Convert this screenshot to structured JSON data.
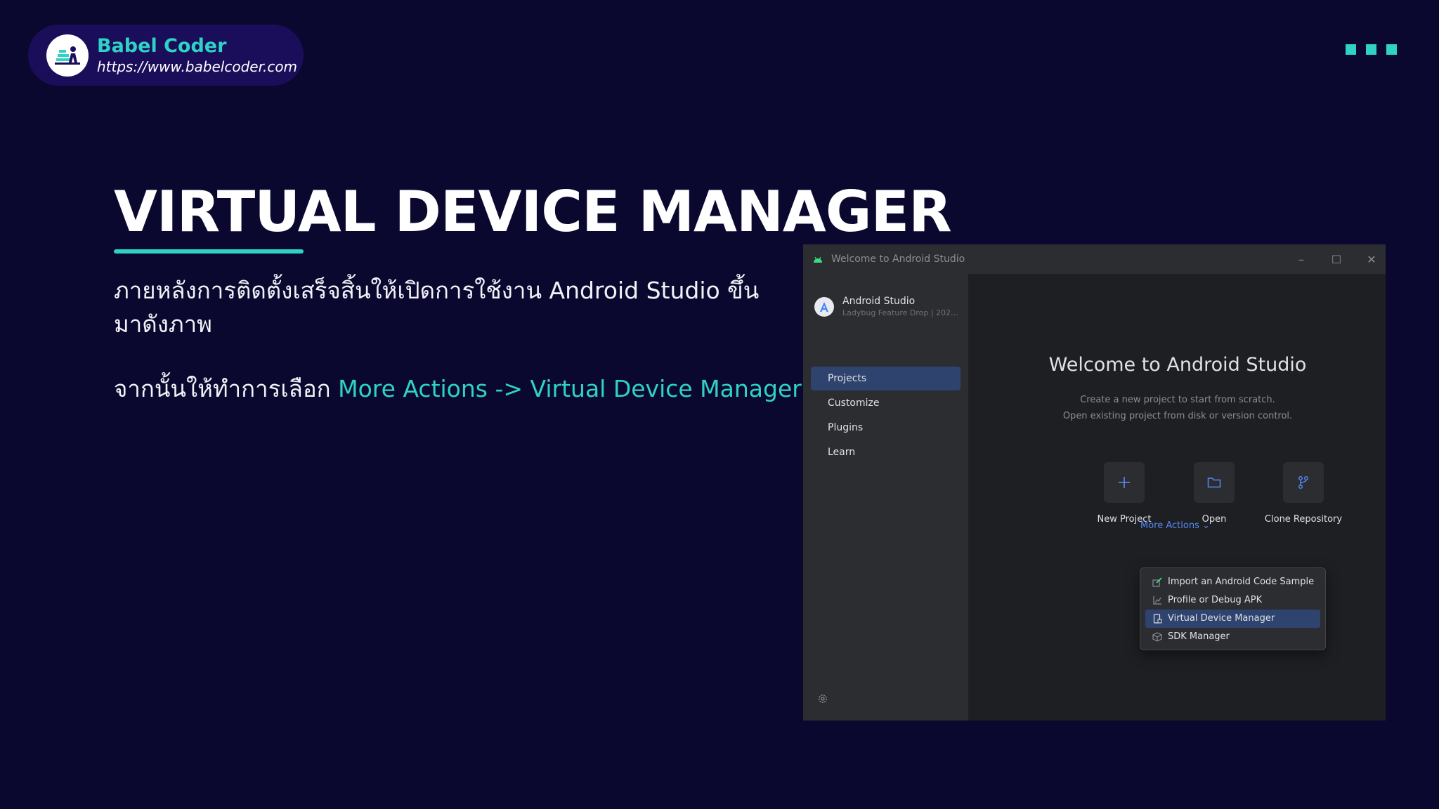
{
  "brand": {
    "name": "Babel Coder",
    "url": "https://www.babelcoder.com"
  },
  "slide": {
    "title": "VIRTUAL DEVICE MANAGER",
    "paragraph1": "ภายหลังการติดตั้งเสร็จสิ้นให้เปิดการใช้งาน Android Studio ขึ้นมาดังภาพ",
    "paragraph2_prefix": "จากนั้นให้ทำการเลือก ",
    "paragraph2_highlight": "More Actions -> Virtual Device Manager"
  },
  "window": {
    "title": "Welcome to Android Studio",
    "controls": [
      "–",
      "☐",
      "✕"
    ],
    "product_name": "Android Studio",
    "product_version": "Ladybug Feature Drop | 202…",
    "nav": [
      "Projects",
      "Customize",
      "Plugins",
      "Learn"
    ],
    "welcome_title": "Welcome to Android Studio",
    "subtitle1": "Create a new project to start from scratch.",
    "subtitle2": "Open existing project from disk or version control.",
    "actions": [
      "New Project",
      "Open",
      "Clone Repository"
    ],
    "more_actions_label": "More Actions ⌄",
    "menu": [
      "Import an Android Code Sample",
      "Profile or Debug APK",
      "Virtual Device Manager",
      "SDK Manager"
    ]
  },
  "colors": {
    "background": "#0b0830",
    "accent": "#2ed3c6",
    "brand_pill": "#1a0e5a",
    "ide_selection": "#2e436e",
    "ide_link": "#548af7"
  },
  "icons": {
    "window": "android-icon",
    "gear": "gear-icon",
    "new_project": "plus-icon",
    "open": "folder-icon",
    "clone": "branch-icon"
  }
}
